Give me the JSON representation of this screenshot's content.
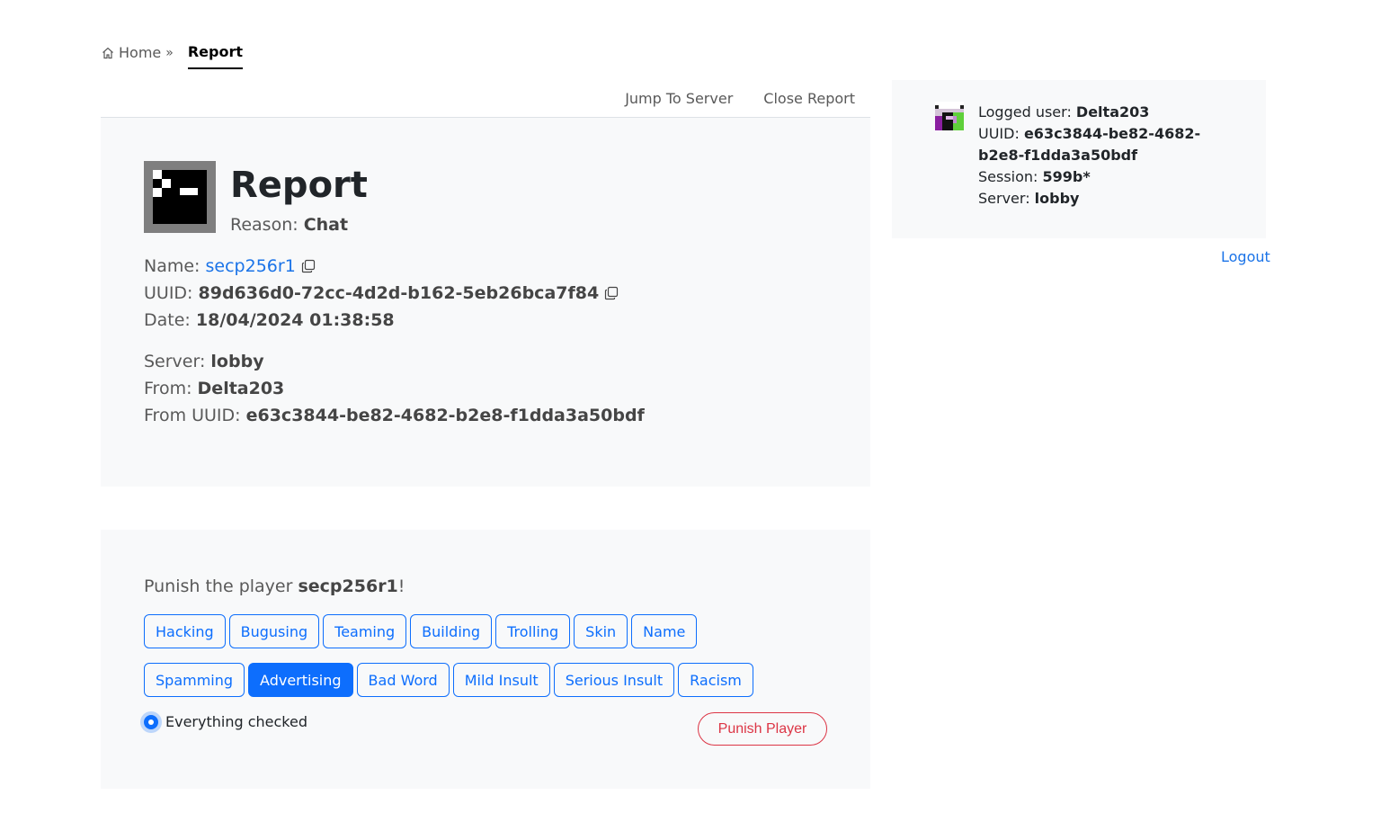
{
  "breadcrumb": {
    "home": "Home",
    "separator": "»",
    "current": "Report"
  },
  "tabs": {
    "jump": "Jump To Server",
    "close": "Close Report"
  },
  "report": {
    "title": "Report",
    "reason_label": "Reason:",
    "reason": "Chat",
    "name_label": "Name:",
    "name": "secp256r1",
    "uuid_label": "UUID:",
    "uuid": "89d636d0-72cc-4d2d-b162-5eb26bca7f84",
    "date_label": "Date:",
    "date": "18/04/2024 01:38:58",
    "server_label": "Server:",
    "server": "lobby",
    "from_label": "From:",
    "from": "Delta203",
    "from_uuid_label": "From UUID:",
    "from_uuid": "e63c3844-be82-4682-b2e8-f1dda3a50bdf"
  },
  "punish": {
    "prefix": "Punish the player",
    "player": "secp256r1",
    "suffix": "!",
    "row1": [
      "Hacking",
      "Bugusing",
      "Teaming",
      "Building",
      "Trolling",
      "Skin",
      "Name"
    ],
    "row2": [
      "Spamming",
      "Advertising",
      "Bad Word",
      "Mild Insult",
      "Serious Insult",
      "Racism"
    ],
    "selected": "Advertising",
    "checkbox_label": "Everything checked",
    "button": "Punish Player"
  },
  "user": {
    "logged_label": "Logged user:",
    "logged": "Delta203",
    "uuid_label": "UUID:",
    "uuid": "e63c3844-be82-4682-b2e8-f1dda3a50bdf",
    "session_label": "Session:",
    "session": "599b*",
    "server_label": "Server:",
    "server": "lobby",
    "logout": "Logout"
  },
  "colors": {
    "primary": "#0d6efd",
    "danger": "#dc3545",
    "link": "#1a73e8",
    "card_bg": "#f8f9fa"
  }
}
